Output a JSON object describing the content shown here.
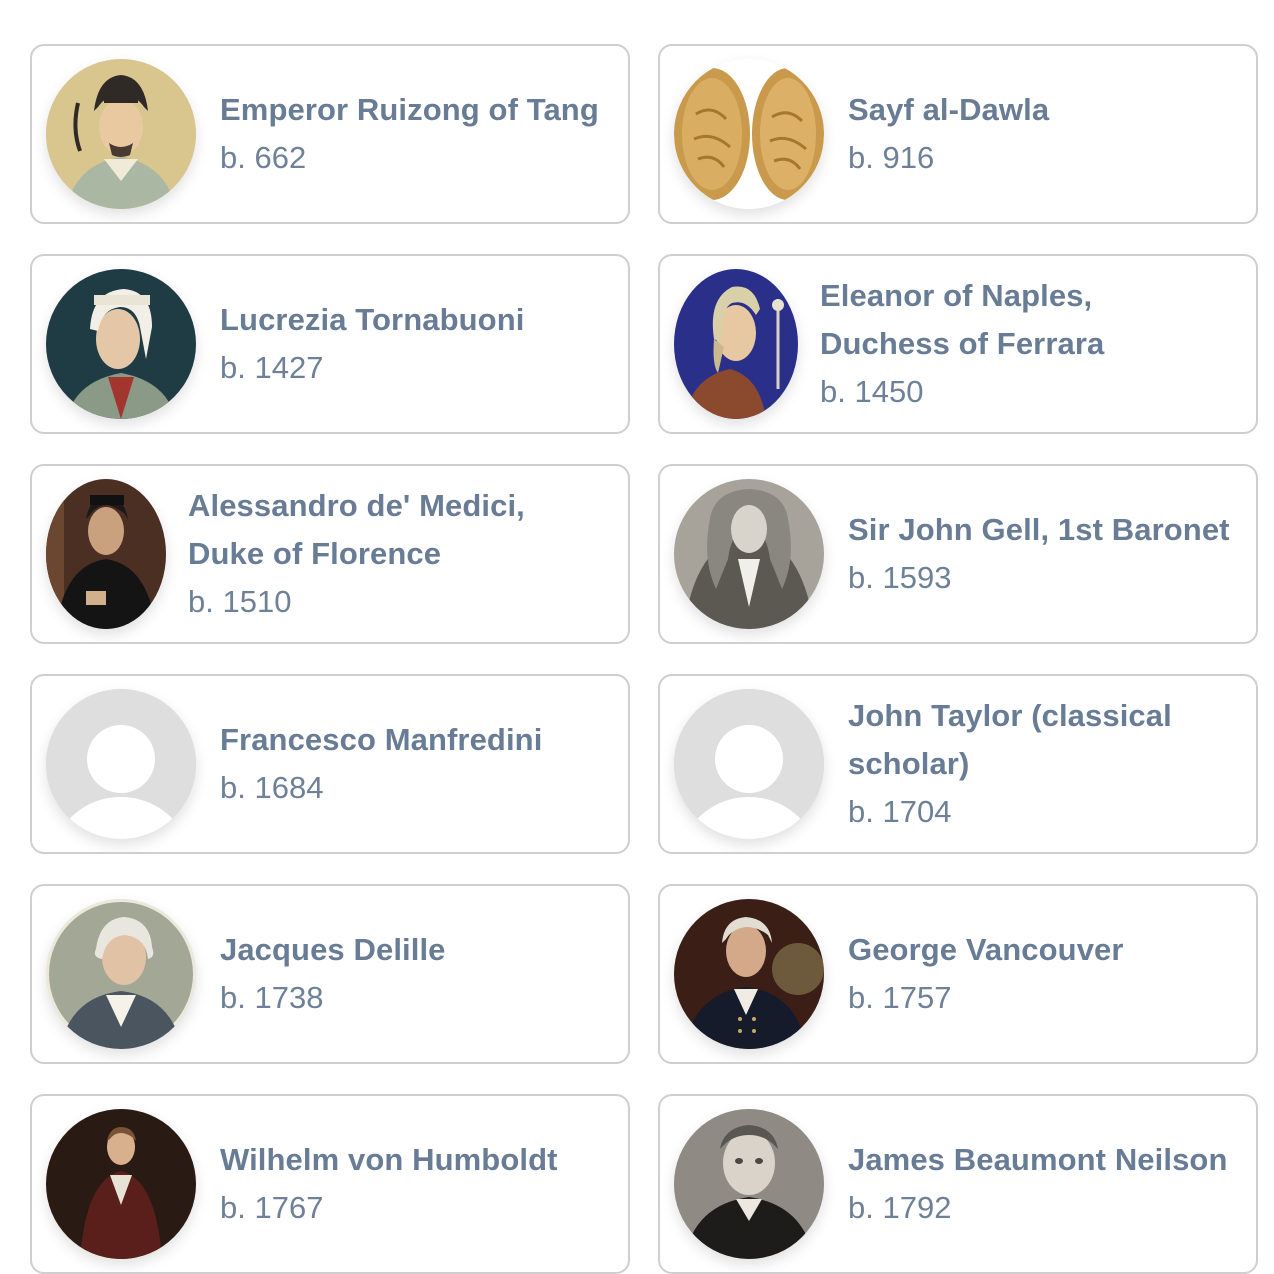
{
  "people": [
    {
      "name": "Emperor Ruizong of Tang",
      "born": "b. 662",
      "avatar_icon": "portrait-ruizong-icon"
    },
    {
      "name": "Sayf al-Dawla",
      "born": "b. 916",
      "avatar_icon": "gold-coins-icon"
    },
    {
      "name": "Lucrezia Tornabuoni",
      "born": "b. 1427",
      "avatar_icon": "portrait-lucrezia-icon"
    },
    {
      "name": "Eleanor of Naples, Duchess of Ferrara",
      "born": "b. 1450",
      "avatar_icon": "portrait-eleanor-icon"
    },
    {
      "name": "Alessandro de' Medici, Duke of Florence",
      "born": "b. 1510",
      "avatar_icon": "portrait-alessandro-icon"
    },
    {
      "name": "Sir John Gell, 1st Baronet",
      "born": "b. 1593",
      "avatar_icon": "portrait-gell-icon"
    },
    {
      "name": "Francesco Manfredini",
      "born": "b. 1684",
      "avatar_icon": "user-placeholder-icon"
    },
    {
      "name": "John Taylor (classical scholar)",
      "born": "b. 1704",
      "avatar_icon": "user-placeholder-icon"
    },
    {
      "name": "Jacques Delille",
      "born": "b. 1738",
      "avatar_icon": "portrait-delille-icon"
    },
    {
      "name": "George Vancouver",
      "born": "b. 1757",
      "avatar_icon": "portrait-vancouver-icon"
    },
    {
      "name": "Wilhelm von Humboldt",
      "born": "b. 1767",
      "avatar_icon": "portrait-humboldt-icon"
    },
    {
      "name": "James Beaumont Neilson",
      "born": "b. 1792",
      "avatar_icon": "portrait-neilson-icon"
    }
  ],
  "colors": {
    "name_text": "#687c96",
    "card_border": "#cfcfd1",
    "placeholder": "#dedede"
  }
}
